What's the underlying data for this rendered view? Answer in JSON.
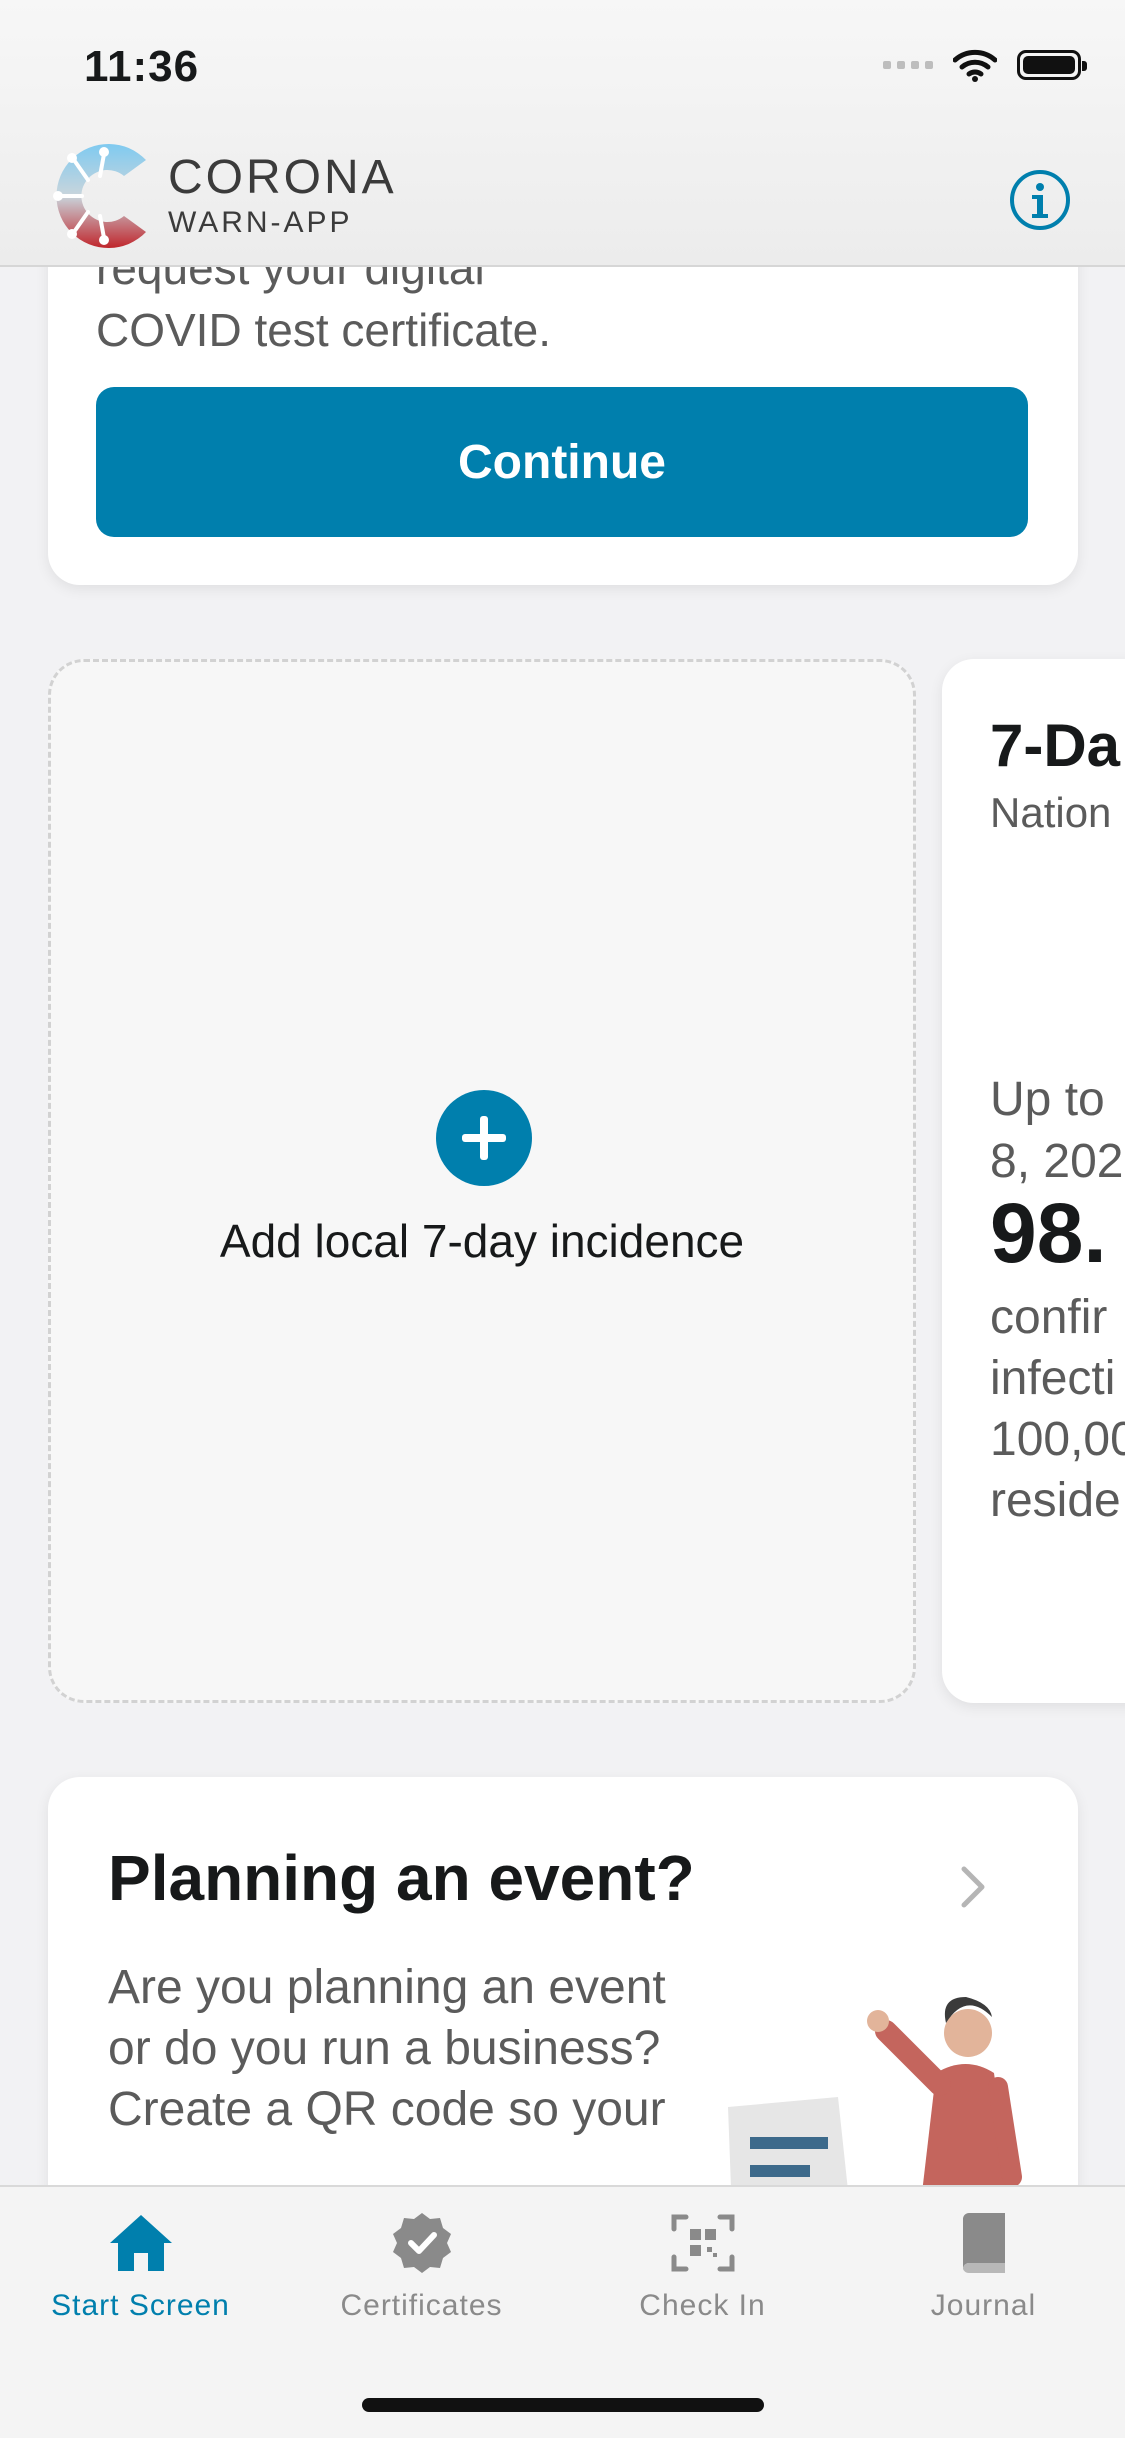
{
  "status_bar": {
    "time": "11:36"
  },
  "header": {
    "brand_main": "CORONA",
    "brand_sub": "WARN-APP",
    "info_icon": "info-circle-icon"
  },
  "test_card": {
    "partial_text_top": "request your digital",
    "partial_text": "COVID test certificate.",
    "continue_label": "Continue"
  },
  "local_incidence": {
    "label": "Add local 7-day incidence",
    "icon": "plus-circle-icon"
  },
  "incidence_card": {
    "title": "7-Da",
    "subtitle": "Nation",
    "up_to_lines": [
      "Up to",
      "8, 202"
    ],
    "value": "98.",
    "desc_lines": [
      "confir",
      "infecti",
      "100,00",
      "reside"
    ]
  },
  "event_card": {
    "title": "Planning an event?",
    "body": "Are you planning an event or do you run a business? Create a QR code so your"
  },
  "tabs": [
    {
      "label": "Start Screen",
      "icon": "home-icon",
      "active": true
    },
    {
      "label": "Certificates",
      "icon": "certificate-badge-icon",
      "active": false
    },
    {
      "label": "Check In",
      "icon": "qr-scan-icon",
      "active": false
    },
    {
      "label": "Journal",
      "icon": "book-icon",
      "active": false
    }
  ],
  "colors": {
    "accent": "#007fad",
    "text": "#17191a",
    "secondary": "#5b5b5b",
    "tab_inactive": "#8a8a8a"
  }
}
